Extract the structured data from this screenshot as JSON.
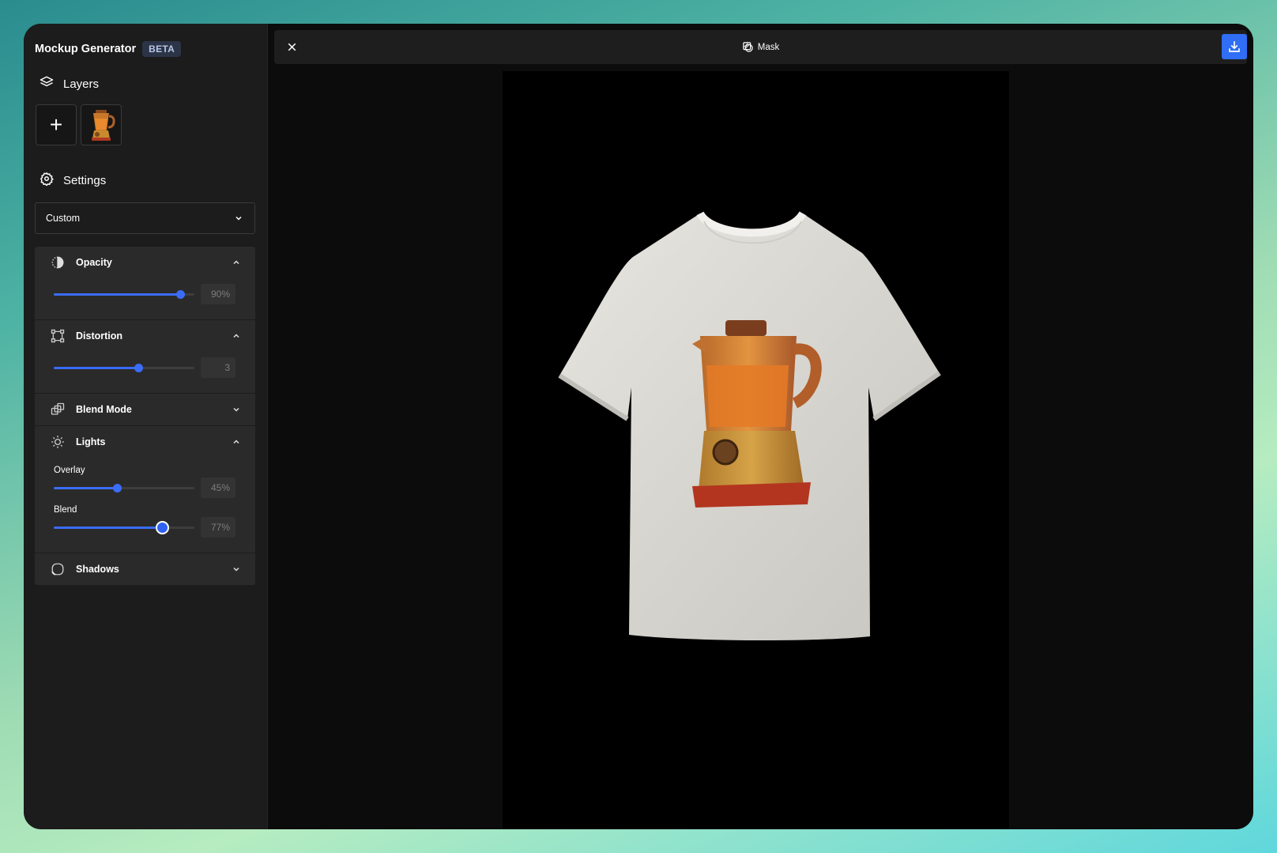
{
  "app": {
    "title": "Mockup Generator",
    "badge": "BETA"
  },
  "sidebar": {
    "layers_label": "Layers",
    "settings_label": "Settings",
    "preset": "Custom",
    "sections": {
      "opacity": {
        "label": "Opacity",
        "value_text": "90%",
        "level": 0.9,
        "expanded": true
      },
      "distortion": {
        "label": "Distortion",
        "value_text": "3",
        "level": 0.6,
        "expanded": true
      },
      "blend_mode": {
        "label": "Blend Mode",
        "expanded": false
      },
      "lights": {
        "label": "Lights",
        "expanded": true,
        "overlay": {
          "label": "Overlay",
          "value_text": "45%",
          "level": 0.45
        },
        "blend": {
          "label": "Blend",
          "value_text": "77%",
          "level": 0.77
        }
      },
      "shadows": {
        "label": "Shadows",
        "expanded": false
      }
    }
  },
  "toolbar": {
    "mask_label": "Mask"
  },
  "colors": {
    "accent": "#3b6cf6",
    "sidebar_bg": "#1c1c1c",
    "panel_bg": "#2a2a2a"
  },
  "icons": {
    "layers": "layers-icon",
    "settings": "gear-icon",
    "opacity": "half-circle-icon",
    "distortion": "transform-icon",
    "blend_mode": "stack-icon",
    "lights": "sun-icon",
    "shadows": "rounded-square-icon",
    "close": "close-icon",
    "mask": "mask-icon",
    "download": "download-icon"
  }
}
